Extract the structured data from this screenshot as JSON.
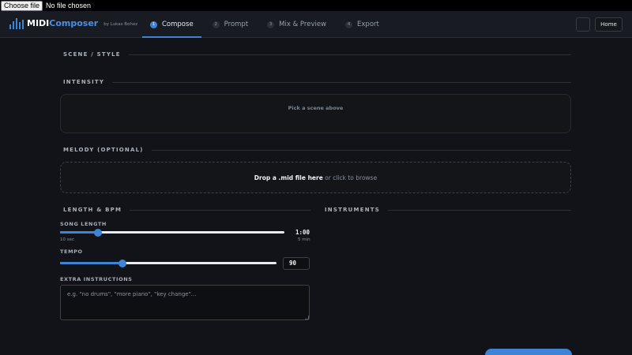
{
  "file_input": {
    "button_label": "Choose file",
    "status": "No file chosen"
  },
  "header": {
    "logo_primary": "MIDI",
    "logo_accent": "Composer",
    "byline": "by Lukas Bohez",
    "tabs": [
      {
        "num": "1",
        "label": "Compose",
        "active": true
      },
      {
        "num": "2",
        "label": "Prompt",
        "active": false
      },
      {
        "num": "3",
        "label": "Mix & Preview",
        "active": false
      },
      {
        "num": "4",
        "label": "Export",
        "active": false
      }
    ],
    "home_label": "Home"
  },
  "sections": {
    "scene_style": "SCENE / STYLE",
    "intensity": "INTENSITY",
    "intensity_placeholder": "Pick a scene above",
    "melody": "MELODY (OPTIONAL)",
    "drop_bold": "Drop a .mid file here",
    "drop_rest": " or click to browse",
    "length_bpm": "LENGTH & BPM",
    "instruments": "INSTRUMENTS"
  },
  "song_length": {
    "label": "SONG LENGTH",
    "value": "1:00",
    "min_label": "10 sec",
    "max_label": "5 min",
    "fraction": 0.17
  },
  "tempo": {
    "label": "TEMPO",
    "value": "90",
    "fraction": 0.29
  },
  "extra": {
    "label": "EXTRA INSTRUCTIONS",
    "placeholder": "e.g. \"no drums\", \"more piano\", \"key change\"..."
  },
  "colors": {
    "accent": "#3d84d6",
    "background": "#111318",
    "header": "#181b21"
  }
}
